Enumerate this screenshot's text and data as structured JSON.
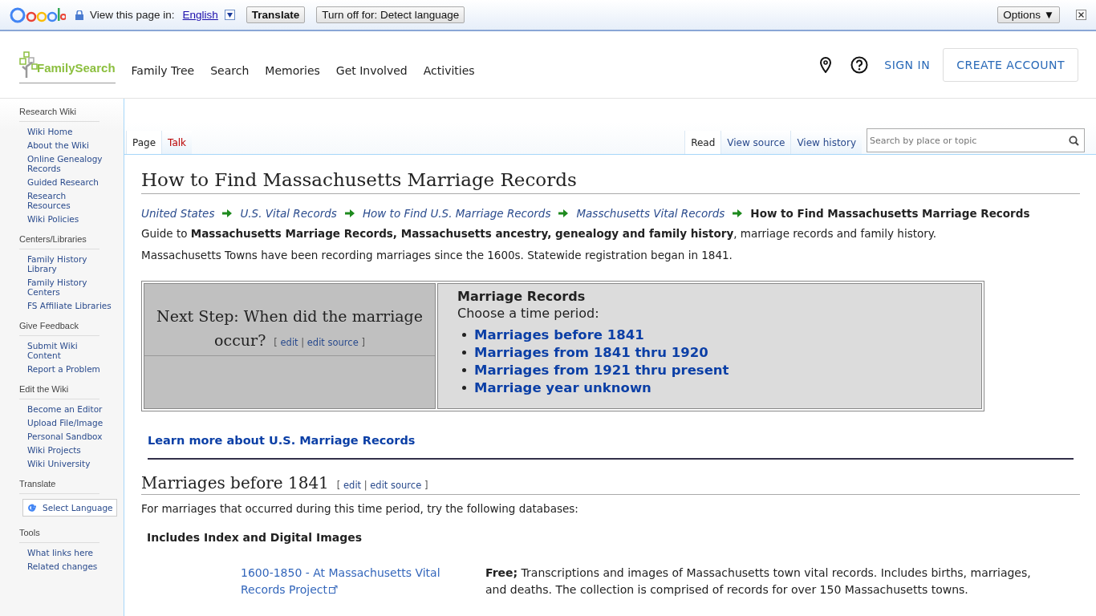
{
  "translate_bar": {
    "view_label": "View this page in:",
    "language": "English",
    "buttons": [
      "Translate",
      "Turn off for: Detect language"
    ],
    "options": "Options ▼"
  },
  "header": {
    "logo": "FamilySearch",
    "nav": [
      "Family Tree",
      "Search",
      "Memories",
      "Get Involved",
      "Activities"
    ],
    "sign_in": "SIGN IN",
    "create_account": "CREATE ACCOUNT"
  },
  "sidebar": [
    {
      "title": "Research Wiki",
      "kind": "links",
      "items": [
        "Wiki Home",
        "About the Wiki",
        "Online Genealogy Records",
        "Guided Research",
        "Research Resources",
        "Wiki Policies"
      ]
    },
    {
      "title": "Centers/Libraries",
      "kind": "links",
      "items": [
        "Family History Library",
        "Family History Centers",
        "FS Affiliate Libraries"
      ]
    },
    {
      "title": "Give Feedback",
      "kind": "links",
      "items": [
        "Submit Wiki Content",
        "Report a Problem"
      ]
    },
    {
      "title": "Edit the Wiki",
      "kind": "links",
      "items": [
        "Become an Editor",
        "Upload File/Image",
        "Personal Sandbox",
        "Wiki Projects",
        "Wiki University"
      ]
    },
    {
      "title": "Translate",
      "kind": "widget",
      "items": [
        "Select Language"
      ]
    },
    {
      "title": "Tools",
      "kind": "links",
      "items": [
        "What links here",
        "Related changes"
      ]
    }
  ],
  "page_tabs": [
    {
      "label": "Page",
      "selected": true,
      "missing": false
    },
    {
      "label": "Talk",
      "selected": false,
      "missing": true
    }
  ],
  "view_tabs": [
    {
      "label": "Read",
      "selected": true
    },
    {
      "label": "View source",
      "selected": false
    },
    {
      "label": "View history",
      "selected": false
    }
  ],
  "search": {
    "placeholder": "Search by place or topic"
  },
  "title": "How to Find Massachusetts Marriage Records",
  "breadcrumbs": [
    "United States",
    "U.S. Vital Records",
    "How to Find U.S. Marriage Records",
    "Masschusetts Vital Records"
  ],
  "breadcrumb_current": "How to Find Massachusetts Marriage Records",
  "intro": "Guide to **Massachusetts Marriage Records, Massachusetts ancestry, genealogy and family history**, marriage records and family history.",
  "paragraph": "Massachusetts Towns have been recording marriages since the 1600s. Statewide registration began in 1841.",
  "next_step": {
    "heading_lines": [
      "Next Step: When did the marriage",
      "occur?"
    ],
    "open": "[",
    "edit": "edit",
    "sep": "|",
    "edit_source": "edit source",
    "close": "]"
  },
  "records_panel": {
    "title": "Marriage Records",
    "subtitle": "Choose a time period:",
    "links": [
      "Marriages before 1841",
      "Marriages from 1841 thru 1920",
      "Marriages from 1921 thru present",
      "Marriage year unknown"
    ]
  },
  "learn_more": "Learn more about U.S. Marriage Records",
  "section": {
    "heading": "Marriages before 1841",
    "open": "[",
    "edit": "edit",
    "sep": "|",
    "edit_source": "edit source",
    "close": "]",
    "text": "For marriages that occurred during this time period, try the following databases:",
    "subheading": "Includes Index and Digital Images",
    "databases": [
      {
        "link": "1600-1850 - At Massachusetts Vital Records Project",
        "description": "**Free;** Transcriptions and images of Massachusetts town vital records. Includes births, marriages, and deaths. The collection is comprised of records for over 150 Massachusetts towns."
      }
    ]
  }
}
